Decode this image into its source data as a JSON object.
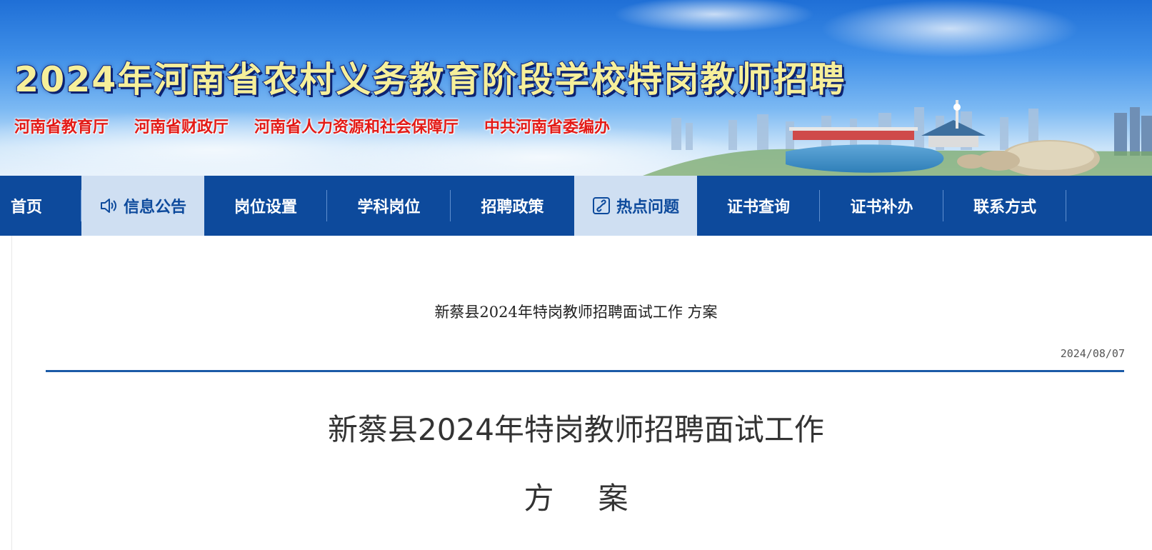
{
  "header": {
    "title": "2024年河南省农村义务教育阶段学校特岗教师招聘",
    "sponsors": [
      "河南省教育厅",
      "河南省财政厅",
      "河南省人力资源和社会保障厅",
      "中共河南省委编办"
    ]
  },
  "nav": {
    "items": [
      {
        "label": "首页",
        "active": false
      },
      {
        "label": "信息公告",
        "active": true,
        "icon": "speaker-icon"
      },
      {
        "label": "岗位设置",
        "active": false
      },
      {
        "label": "学科岗位",
        "active": false
      },
      {
        "label": "招聘政策",
        "active": false
      },
      {
        "label": "热点问题",
        "active": true,
        "icon": "link-icon"
      },
      {
        "label": "证书查询",
        "active": false
      },
      {
        "label": "证书补办",
        "active": false
      },
      {
        "label": "联系方式",
        "active": false
      }
    ]
  },
  "article": {
    "title": "新蔡县2024年特岗教师招聘面试工作 方案",
    "date": "2024/08/07",
    "doc_title": "新蔡县2024年特岗教师招聘面试工作",
    "doc_subtitle": "方案"
  },
  "colors": {
    "nav_bg": "#0d4a9c",
    "nav_active_bg": "#cfdff2",
    "title_fill": "#f6ef9a",
    "sponsor_red": "#e31b17",
    "divider": "#1b5aa7"
  }
}
